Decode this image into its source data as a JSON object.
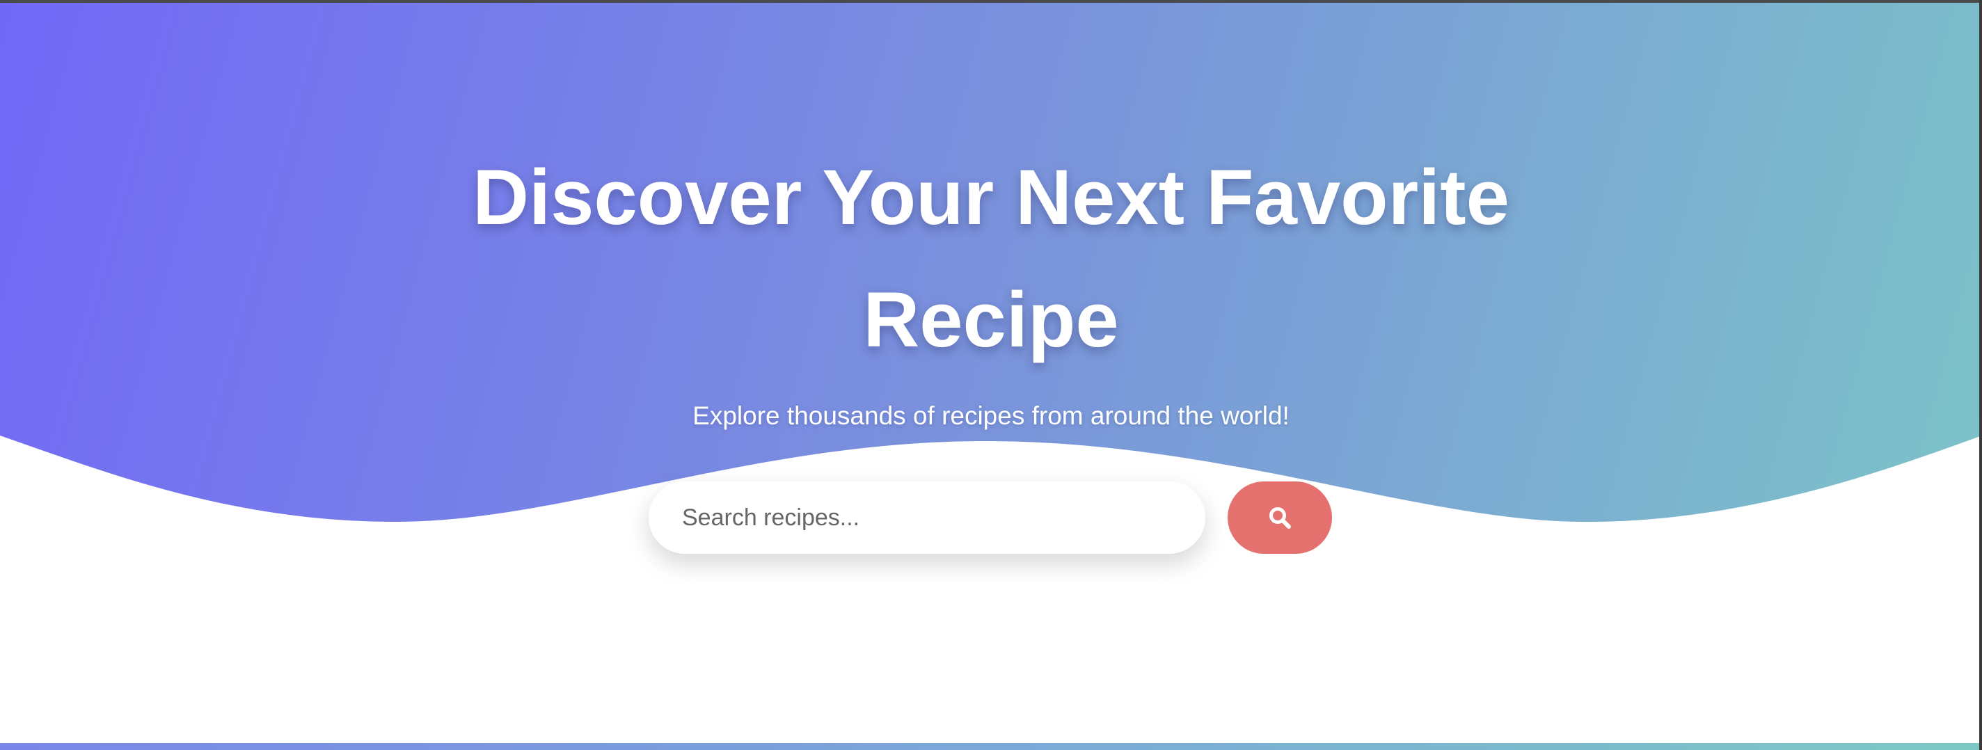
{
  "hero": {
    "title": "Discover Your Next Favorite Recipe",
    "subtitle": "Explore thousands of recipes from around the world!",
    "gradient_start": "#7268f7",
    "gradient_mid": "#7a92dc",
    "gradient_end": "#7cc3c8"
  },
  "search": {
    "placeholder": "Search recipes...",
    "value": "",
    "button_icon": "search-icon",
    "button_color": "#e5716e"
  }
}
